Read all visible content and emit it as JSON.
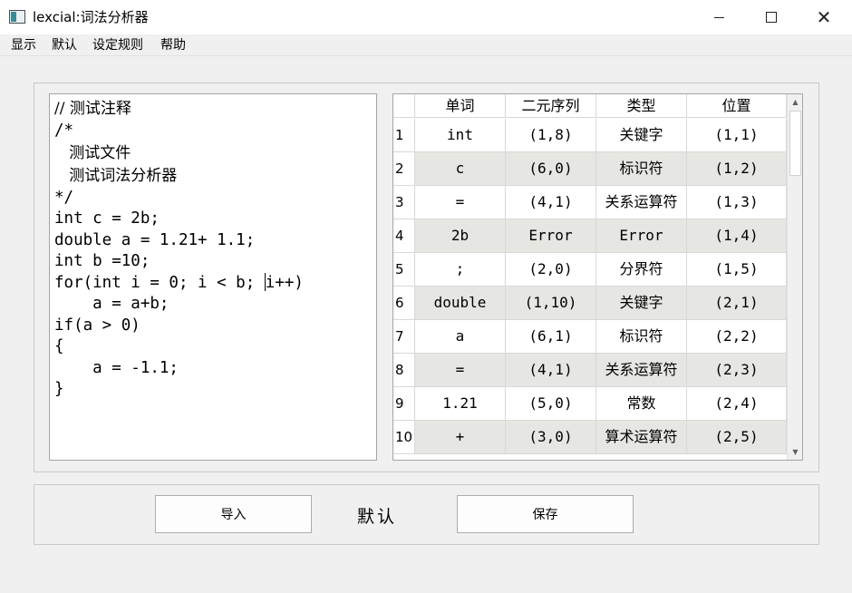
{
  "window": {
    "title": "lexcial:词法分析器",
    "minimize_glyph": "",
    "maximize_glyph": "",
    "close_glyph": "✕"
  },
  "menu": [
    "显示",
    "默认",
    "设定规则",
    "帮助"
  ],
  "editor": {
    "lines": [
      "// 测试注释",
      "/*",
      "   测试文件",
      "   测试词法分析器",
      "*/",
      "int c = 2b;",
      "double a = 1.21+ 1.1;",
      "int b =10;",
      "for(int i = 0; i < b; ",
      "    a = a+b;",
      "if(a > 0)",
      "{",
      "    a = -1.1;",
      "}"
    ],
    "caret_line_tail": "i++)"
  },
  "table": {
    "headers": [
      "单词",
      "二元序列",
      "类型",
      "位置"
    ],
    "rows": [
      {
        "index": "1",
        "word": "int",
        "pair": "(1,8)",
        "type": "关键字",
        "pos": "(1,1)"
      },
      {
        "index": "2",
        "word": "c",
        "pair": "(6,0)",
        "type": "标识符",
        "pos": "(1,2)"
      },
      {
        "index": "3",
        "word": "=",
        "pair": "(4,1)",
        "type": "关系运算符",
        "pos": "(1,3)"
      },
      {
        "index": "4",
        "word": "2b",
        "pair": "Error",
        "type": "Error",
        "pos": "(1,4)"
      },
      {
        "index": "5",
        "word": ";",
        "pair": "(2,0)",
        "type": "分界符",
        "pos": "(1,5)"
      },
      {
        "index": "6",
        "word": "double",
        "pair": "(1,10)",
        "type": "关键字",
        "pos": "(2,1)"
      },
      {
        "index": "7",
        "word": "a",
        "pair": "(6,1)",
        "type": "标识符",
        "pos": "(2,2)"
      },
      {
        "index": "8",
        "word": "=",
        "pair": "(4,1)",
        "type": "关系运算符",
        "pos": "(2,3)"
      },
      {
        "index": "9",
        "word": "1.21",
        "pair": "(5,0)",
        "type": "常数",
        "pos": "(2,4)"
      },
      {
        "index": "10",
        "word": "+",
        "pair": "(3,0)",
        "type": "算术运算符",
        "pos": "(2,5)"
      }
    ]
  },
  "buttons": {
    "import_label": "导入",
    "save_label": "保存"
  },
  "mode_label": "默认",
  "scrollbar": {
    "up_arrow": "▲",
    "down_arrow": "▼"
  },
  "colors": {
    "alt_row": "#e6e6e2",
    "window_bg": "#f0f0f0"
  }
}
